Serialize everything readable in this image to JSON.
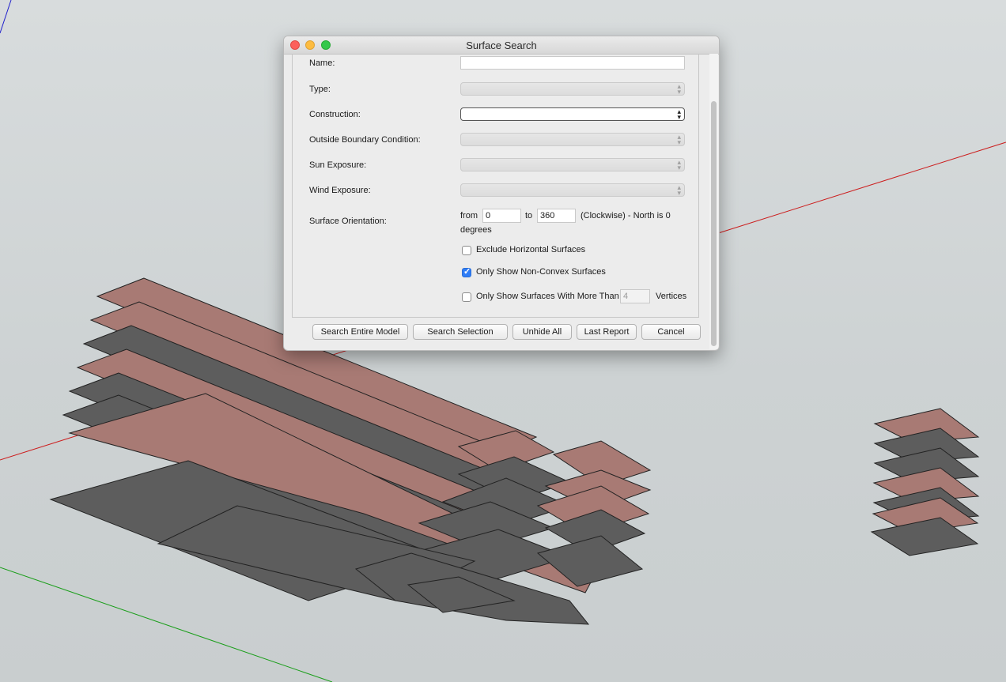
{
  "dialog": {
    "title": "Surface Search",
    "fields": {
      "name_label": "Name:",
      "name_value": "",
      "type_label": "Type:",
      "construction_label": "Construction:",
      "obc_label": "Outside Boundary Condition:",
      "sun_label": "Sun Exposure:",
      "wind_label": "Wind Exposure:"
    },
    "orientation": {
      "label": "Surface Orientation:",
      "from_label": "from",
      "from_value": "0",
      "to_label": "to",
      "to_value": "360",
      "note": "(Clockwise) - North is 0",
      "note_cont": "degrees"
    },
    "options": {
      "exclude_horizontal": {
        "label": "Exclude Horizontal Surfaces",
        "checked": false
      },
      "non_convex": {
        "label": "Only Show Non-Convex Surfaces",
        "checked": true
      },
      "more_than": {
        "label": "Only Show Surfaces With More Than",
        "checked": false,
        "value": "4",
        "suffix": "Vertices"
      }
    },
    "buttons": {
      "search_entire": "Search Entire Model",
      "search_selection": "Search Selection",
      "unhide_all": "Unhide All",
      "last_report": "Last Report",
      "cancel": "Cancel"
    }
  },
  "colors": {
    "face_gray": "#5d5d5d",
    "face_pink": "#a87a74",
    "axis_red": "#cc1e1e",
    "axis_green": "#1a9e1a",
    "axis_blue": "#2020cc"
  }
}
